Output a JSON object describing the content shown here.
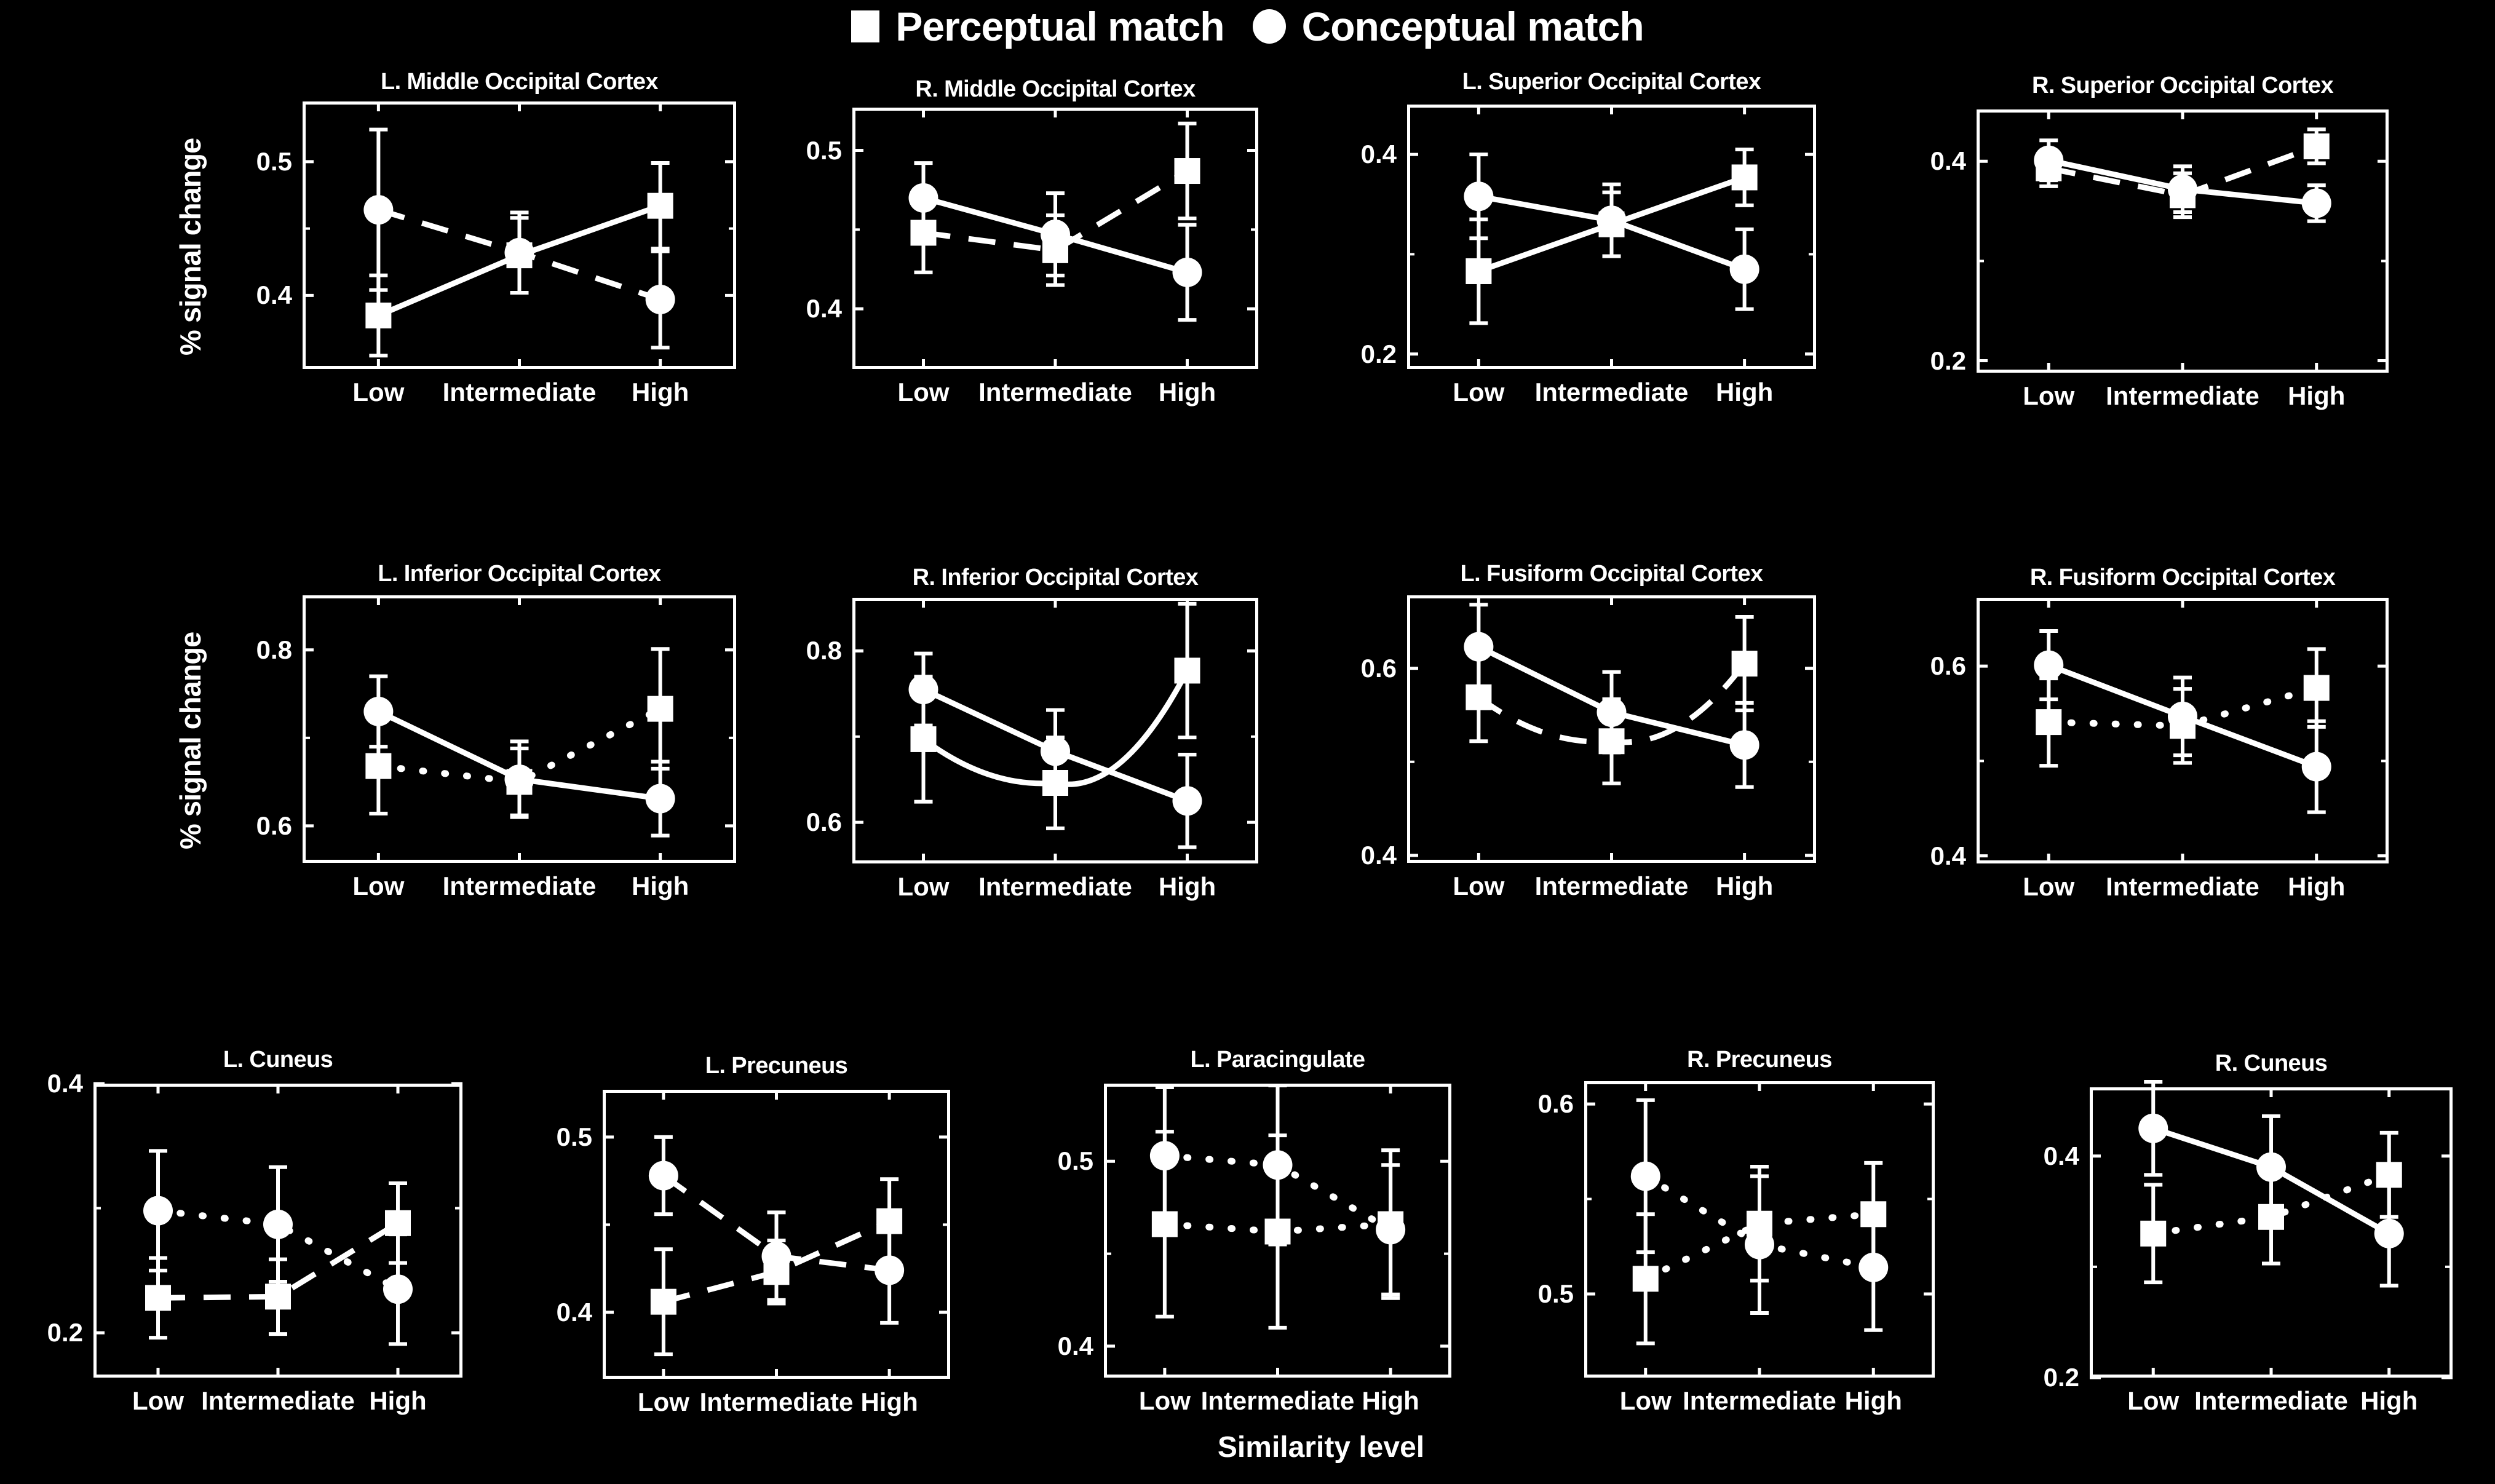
{
  "legend": {
    "items": [
      {
        "icon": "square-marker-icon",
        "label": "Perceptual match"
      },
      {
        "icon": "circle-marker-icon",
        "label": "Conceptual match"
      }
    ]
  },
  "axis_titles": {
    "y": "% signal change",
    "x": "Similarity level"
  },
  "x_categories": [
    "Low",
    "Intermediate",
    "High"
  ],
  "chart_data": [
    {
      "type": "line",
      "title": "L. Middle Occipital Cortex",
      "xlabel": "",
      "ylabel": "% signal change",
      "categories": [
        "Low",
        "Intermediate",
        "High"
      ],
      "yticks": [
        0.4,
        0.5
      ],
      "ylim": [
        0.345,
        0.545
      ],
      "grid": false,
      "legend_position": "top-center",
      "series": [
        {
          "name": "Perceptual match",
          "marker": "square",
          "linestyle": "solid",
          "values": [
            0.385,
            0.43,
            0.467
          ],
          "errors": [
            0.03,
            0.028,
            0.032
          ]
        },
        {
          "name": "Conceptual match",
          "marker": "circle",
          "linestyle": "dashed",
          "values": [
            0.464,
            0.432,
            0.397
          ],
          "errors": [
            0.06,
            0.03,
            0.036
          ]
        }
      ]
    },
    {
      "type": "line",
      "title": "R. Middle Occipital Cortex",
      "xlabel": "",
      "ylabel": "",
      "categories": [
        "Low",
        "Intermediate",
        "High"
      ],
      "yticks": [
        0.4,
        0.5
      ],
      "ylim": [
        0.362,
        0.527
      ],
      "grid": false,
      "series": [
        {
          "name": "Perceptual match",
          "marker": "square",
          "linestyle": "dashed",
          "values": [
            0.448,
            0.437,
            0.487
          ],
          "errors": [
            0.025,
            0.022,
            0.03
          ]
        },
        {
          "name": "Conceptual match",
          "marker": "circle",
          "linestyle": "solid",
          "values": [
            0.47,
            0.447,
            0.423
          ],
          "errors": [
            0.022,
            0.026,
            0.03
          ]
        }
      ]
    },
    {
      "type": "line",
      "title": "L. Superior Occipital Cortex",
      "xlabel": "",
      "ylabel": "",
      "categories": [
        "Low",
        "Intermediate",
        "High"
      ],
      "yticks": [
        0.2,
        0.4
      ],
      "ylim": [
        0.185,
        0.45
      ],
      "grid": false,
      "series": [
        {
          "name": "Perceptual match",
          "marker": "square",
          "linestyle": "solid",
          "values": [
            0.283,
            0.33,
            0.377
          ],
          "errors": [
            0.052,
            0.032,
            0.028
          ]
        },
        {
          "name": "Conceptual match",
          "marker": "circle",
          "linestyle": "solid",
          "values": [
            0.358,
            0.334,
            0.285
          ],
          "errors": [
            0.042,
            0.036,
            0.04
          ]
        }
      ]
    },
    {
      "type": "line",
      "title": "R. Superior Occipital Cortex",
      "xlabel": "",
      "ylabel": "",
      "categories": [
        "Low",
        "Intermediate",
        "High"
      ],
      "yticks": [
        0.2,
        0.4
      ],
      "ylim": [
        0.188,
        0.452
      ],
      "grid": false,
      "series": [
        {
          "name": "Perceptual match",
          "marker": "square",
          "linestyle": "dashed",
          "values": [
            0.393,
            0.366,
            0.415
          ],
          "errors": [
            0.018,
            0.022,
            0.017
          ]
        },
        {
          "name": "Conceptual match",
          "marker": "circle",
          "linestyle": "solid",
          "values": [
            0.401,
            0.372,
            0.358
          ],
          "errors": [
            0.02,
            0.023,
            0.018
          ]
        }
      ]
    },
    {
      "type": "line",
      "title": "L. Inferior Occipital Cortex",
      "xlabel": "",
      "ylabel": "% signal change",
      "categories": [
        "Low",
        "Intermediate",
        "High"
      ],
      "yticks": [
        0.6,
        0.8
      ],
      "ylim": [
        0.558,
        0.862
      ],
      "grid": false,
      "series": [
        {
          "name": "Perceptual match",
          "marker": "square",
          "linestyle": "dotted",
          "values": [
            0.668,
            0.65,
            0.733
          ],
          "errors": [
            0.054,
            0.038,
            0.068
          ]
        },
        {
          "name": "Conceptual match",
          "marker": "circle",
          "linestyle": "solid",
          "values": [
            0.73,
            0.653,
            0.631
          ],
          "errors": [
            0.04,
            0.043,
            0.042
          ]
        }
      ]
    },
    {
      "type": "line",
      "title": "R. Inferior Occipital Cortex",
      "xlabel": "",
      "ylabel": "",
      "categories": [
        "Low",
        "Intermediate",
        "High"
      ],
      "yticks": [
        0.6,
        0.8
      ],
      "ylim": [
        0.552,
        0.862
      ],
      "grid": false,
      "series": [
        {
          "name": "Perceptual match",
          "marker": "square",
          "linestyle": "solid-curve",
          "values": [
            0.697,
            0.646,
            0.777
          ],
          "errors": [
            0.073,
            0.053,
            0.078
          ]
        },
        {
          "name": "Conceptual match",
          "marker": "circle",
          "linestyle": "solid",
          "values": [
            0.755,
            0.683,
            0.625
          ],
          "errors": [
            0.042,
            0.048,
            0.054
          ]
        }
      ]
    },
    {
      "type": "line",
      "title": "L. Fusiform Occipital Cortex",
      "xlabel": "",
      "ylabel": "",
      "categories": [
        "Low",
        "Intermediate",
        "High"
      ],
      "yticks": [
        0.4,
        0.6
      ],
      "ylim": [
        0.392,
        0.678
      ],
      "grid": false,
      "series": [
        {
          "name": "Perceptual match",
          "marker": "square",
          "linestyle": "dashed-curve",
          "values": [
            0.569,
            0.522,
            0.605
          ],
          "errors": [
            0.047,
            0.045,
            0.05
          ]
        },
        {
          "name": "Conceptual match",
          "marker": "circle",
          "linestyle": "solid",
          "values": [
            0.623,
            0.553,
            0.518
          ],
          "errors": [
            0.045,
            0.043,
            0.045
          ]
        }
      ]
    },
    {
      "type": "line",
      "title": "R. Fusiform Occipital Cortex",
      "xlabel": "",
      "ylabel": "",
      "categories": [
        "Low",
        "Intermediate",
        "High"
      ],
      "yticks": [
        0.4,
        0.6
      ],
      "ylim": [
        0.392,
        0.672
      ],
      "grid": false,
      "series": [
        {
          "name": "Perceptual match",
          "marker": "square",
          "linestyle": "dotted",
          "values": [
            0.541,
            0.537,
            0.577
          ],
          "errors": [
            0.046,
            0.039,
            0.041
          ]
        },
        {
          "name": "Conceptual match",
          "marker": "circle",
          "linestyle": "solid",
          "values": [
            0.601,
            0.547,
            0.494
          ],
          "errors": [
            0.036,
            0.041,
            0.048
          ]
        }
      ]
    },
    {
      "type": "line",
      "title": "L. Cuneus",
      "xlabel": "",
      "ylabel": "% signal change",
      "categories": [
        "Low",
        "Intermediate",
        "High"
      ],
      "yticks": [
        0.2,
        0.4
      ],
      "ylim": [
        0.164,
        0.4
      ],
      "grid": false,
      "series": [
        {
          "name": "Perceptual match",
          "marker": "square",
          "linestyle": "dashed",
          "values": [
            0.228,
            0.229,
            0.288
          ],
          "errors": [
            0.032,
            0.03,
            0.032
          ]
        },
        {
          "name": "Conceptual match",
          "marker": "circle",
          "linestyle": "dotted",
          "values": [
            0.298,
            0.287,
            0.235
          ],
          "errors": [
            0.048,
            0.046,
            0.044
          ]
        }
      ]
    },
    {
      "type": "line",
      "title": "L. Precuneus",
      "xlabel": "",
      "ylabel": "",
      "categories": [
        "Low",
        "Intermediate",
        "High"
      ],
      "yticks": [
        0.4,
        0.5
      ],
      "ylim": [
        0.362,
        0.527
      ],
      "grid": false,
      "series": [
        {
          "name": "Perceptual match",
          "marker": "square",
          "linestyle": "dashed",
          "values": [
            0.406,
            0.423,
            0.452
          ],
          "errors": [
            0.03,
            0.018,
            0.024
          ]
        },
        {
          "name": "Conceptual match",
          "marker": "circle",
          "linestyle": "dashed",
          "values": [
            0.478,
            0.432,
            0.424
          ],
          "errors": [
            0.022,
            0.025,
            0.03
          ]
        }
      ]
    },
    {
      "type": "line",
      "title": "L. Paracingulate",
      "xlabel": "",
      "ylabel": "",
      "categories": [
        "Low",
        "Intermediate",
        "High"
      ],
      "yticks": [
        0.4,
        0.5
      ],
      "ylim": [
        0.383,
        0.542
      ],
      "grid": false,
      "series": [
        {
          "name": "Perceptual match",
          "marker": "square",
          "linestyle": "dotted",
          "values": [
            0.466,
            0.462,
            0.466
          ],
          "errors": [
            0.05,
            0.052,
            0.04
          ]
        },
        {
          "name": "Conceptual match",
          "marker": "circle",
          "linestyle": "dotted",
          "values": [
            0.503,
            0.498,
            0.463
          ],
          "errors": [
            0.037,
            0.043,
            0.035
          ]
        }
      ]
    },
    {
      "type": "line",
      "title": "R. Precuneus",
      "xlabel": "",
      "ylabel": "",
      "categories": [
        "Low",
        "Intermediate",
        "High"
      ],
      "yticks": [
        0.5,
        0.6
      ],
      "ylim": [
        0.456,
        0.612
      ],
      "grid": false,
      "series": [
        {
          "name": "Perceptual match",
          "marker": "square",
          "linestyle": "dotted",
          "values": [
            0.508,
            0.537,
            0.542
          ],
          "errors": [
            0.034,
            0.03,
            0.027
          ]
        },
        {
          "name": "Conceptual match",
          "marker": "circle",
          "linestyle": "dotted",
          "values": [
            0.562,
            0.526,
            0.514
          ],
          "errors": [
            0.04,
            0.036,
            0.033
          ]
        }
      ]
    },
    {
      "type": "line",
      "title": "R. Cuneus",
      "xlabel": "",
      "ylabel": "",
      "categories": [
        "Low",
        "Intermediate",
        "High"
      ],
      "yticks": [
        0.2,
        0.4
      ],
      "ylim": [
        0.2,
        0.462
      ],
      "grid": false,
      "series": [
        {
          "name": "Perceptual match",
          "marker": "square",
          "linestyle": "dotted",
          "values": [
            0.33,
            0.345,
            0.383
          ],
          "errors": [
            0.044,
            0.042,
            0.038
          ]
        },
        {
          "name": "Conceptual match",
          "marker": "circle",
          "linestyle": "solid",
          "values": [
            0.425,
            0.39,
            0.33
          ],
          "errors": [
            0.042,
            0.046,
            0.047
          ]
        }
      ]
    }
  ],
  "colors": {
    "background": "#000000",
    "foreground": "#ffffff"
  }
}
